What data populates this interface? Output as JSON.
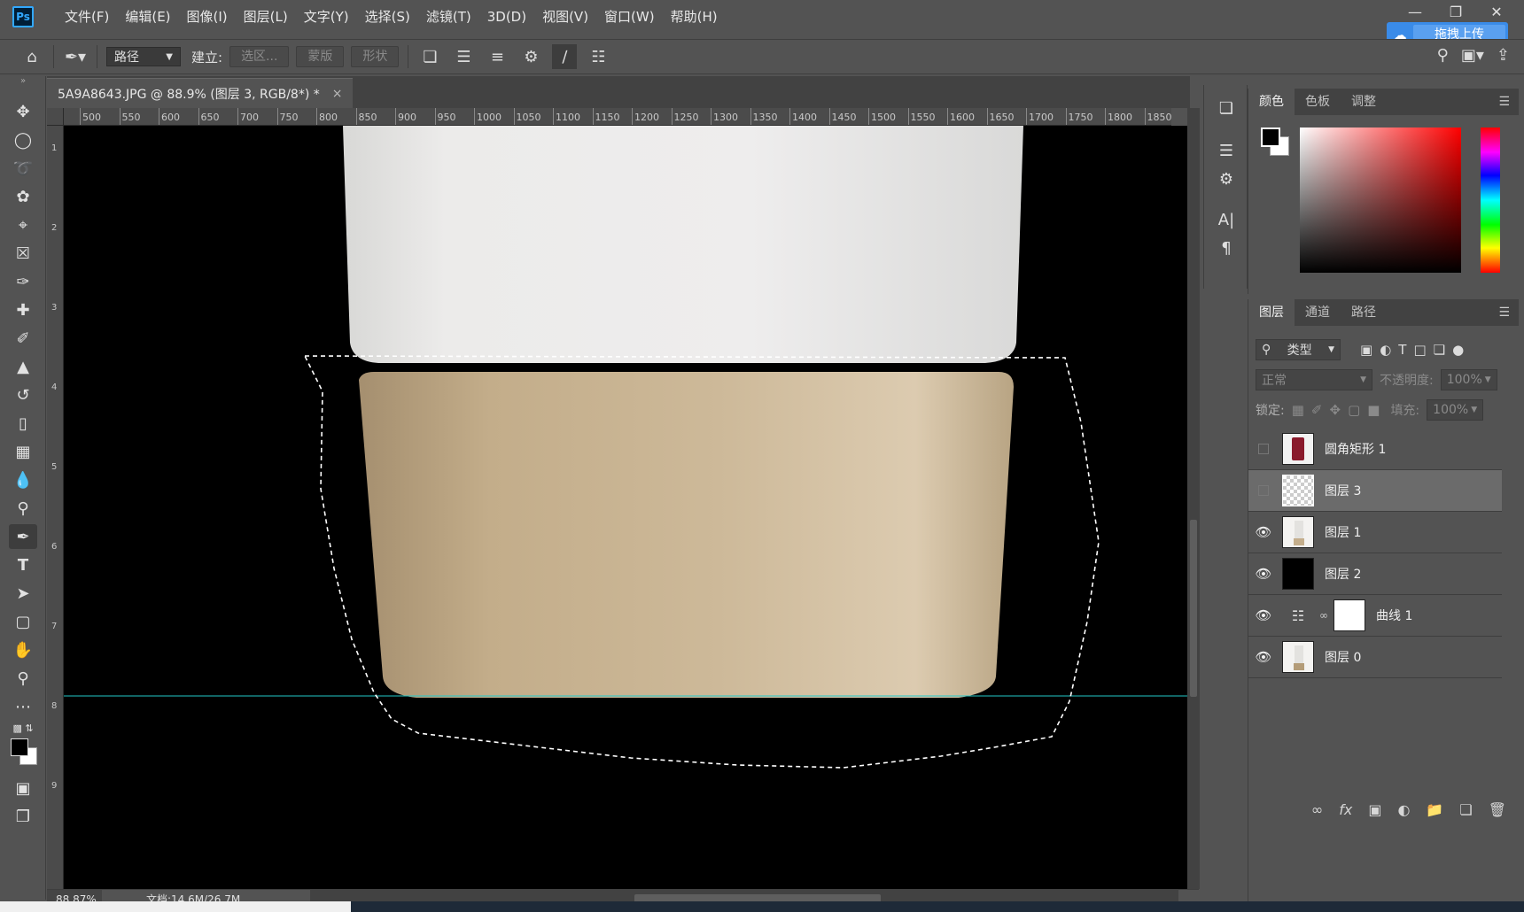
{
  "app": {
    "logo": "Ps",
    "menu": [
      "文件(F)",
      "编辑(E)",
      "图像(I)",
      "图层(L)",
      "文字(Y)",
      "选择(S)",
      "滤镜(T)",
      "3D(D)",
      "视图(V)",
      "窗口(W)",
      "帮助(H)"
    ],
    "window_controls": [
      "minimize-icon",
      "restore-icon",
      "close-icon"
    ],
    "upload_label": "拖拽上传"
  },
  "options": {
    "mode_value": "路径",
    "make_label": "建立:",
    "selection_btn": "选区...",
    "mask_btn": "蒙版",
    "shape_btn": "形状"
  },
  "document": {
    "tab_title": "5A9A8643.JPG @ 88.9% (图层 3, RGB/8*) *",
    "close_glyph": "×",
    "zoom": "88.87%",
    "doc_info": "文档:14.6M/26.7M",
    "ruler_ticks": [
      "500",
      "550",
      "600",
      "650",
      "700",
      "750",
      "800",
      "850",
      "900",
      "950",
      "1000",
      "1050",
      "1100",
      "1150",
      "1200",
      "1250",
      "1300",
      "1350",
      "1400",
      "1450",
      "1500",
      "1550",
      "1600",
      "1650",
      "1700",
      "1750",
      "1800",
      "1850"
    ],
    "vruler_labels": [
      "1",
      "2",
      "3",
      "4",
      "5",
      "6",
      "7",
      "8",
      "9"
    ]
  },
  "color_panel": {
    "tabs": [
      "颜色",
      "色板",
      "调整"
    ],
    "foreground": "#000000",
    "background": "#ffffff"
  },
  "layers_panel": {
    "tabs": [
      "图层",
      "通道",
      "路径"
    ],
    "filter_label": "类型",
    "blend_mode": "正常",
    "opacity_label": "不透明度:",
    "opacity_value": "100%",
    "lock_label": "锁定:",
    "fill_label": "填充:",
    "fill_value": "100%",
    "layers": [
      {
        "name": "圆角矩形 1",
        "visible": false,
        "selected": false,
        "thumb": "red-object"
      },
      {
        "name": "图层 3",
        "visible": false,
        "selected": true,
        "thumb": "transparent"
      },
      {
        "name": "图层 1",
        "visible": true,
        "selected": false,
        "thumb": "bottle"
      },
      {
        "name": "图层 2",
        "visible": true,
        "selected": false,
        "thumb": "black"
      },
      {
        "name": "曲线 1",
        "visible": true,
        "selected": false,
        "thumb": "curves-mask"
      },
      {
        "name": "图层 0",
        "visible": true,
        "selected": false,
        "thumb": "bottle"
      }
    ]
  },
  "colors": {
    "guide": "#22c8c8",
    "selection_accent": "#31a8ff"
  }
}
